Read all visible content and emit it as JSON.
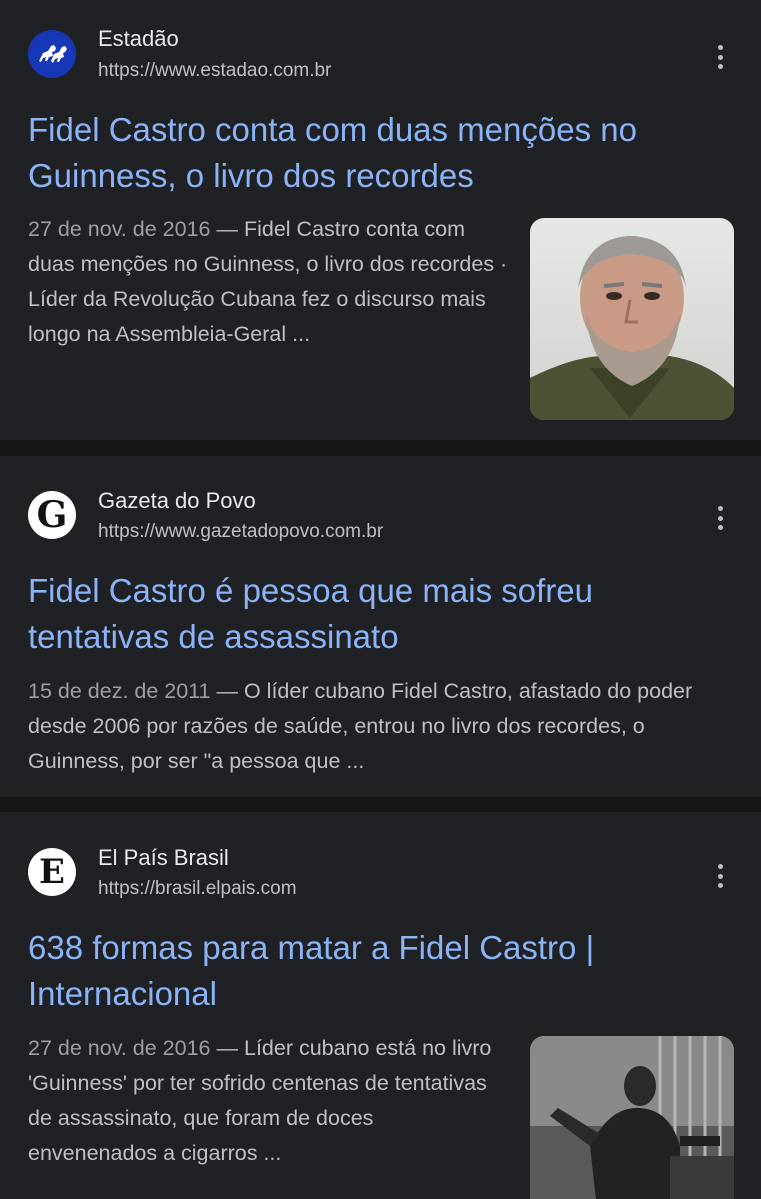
{
  "results": [
    {
      "site_name": "Estadão",
      "url": "https://www.estadao.com.br",
      "title": "Fidel Castro conta com duas menções no Guinness, o livro dos recordes",
      "date": "27 de nov. de 2016",
      "snippet": "Fidel Castro conta com duas menções no Guinness, o livro dos recordes · Líder da Revolução Cubana fez o discurso mais longo na Assembleia-Geral ...",
      "favicon_icon": "horse-knight-icon",
      "has_thumbnail": true
    },
    {
      "site_name": "Gazeta do Povo",
      "url": "https://www.gazetadopovo.com.br",
      "title": "Fidel Castro é pessoa que mais sofreu tentativas de assassinato",
      "date": "15 de dez. de 2011",
      "snippet": "O líder cubano Fidel Castro, afastado do poder desde 2006 por razões de saúde, entrou no livro dos recordes, o Guinness, por ser \"a pessoa que ...",
      "favicon_letter": "G",
      "has_thumbnail": false
    },
    {
      "site_name": "El País Brasil",
      "url": "https://brasil.elpais.com",
      "title": "638 formas para matar a Fidel Castro | Internacional",
      "date": "27 de nov. de 2016",
      "snippet": "Líder cubano está no livro 'Guinness' por ter sofrido centenas de tentativas de assassinato, que foram de doces envenenados a cigarros ...",
      "favicon_letter": "E",
      "has_thumbnail": true
    }
  ],
  "separator": "—",
  "colors": {
    "background": "#202124",
    "link": "#8ab4f8",
    "text": "#bdc1c6"
  }
}
